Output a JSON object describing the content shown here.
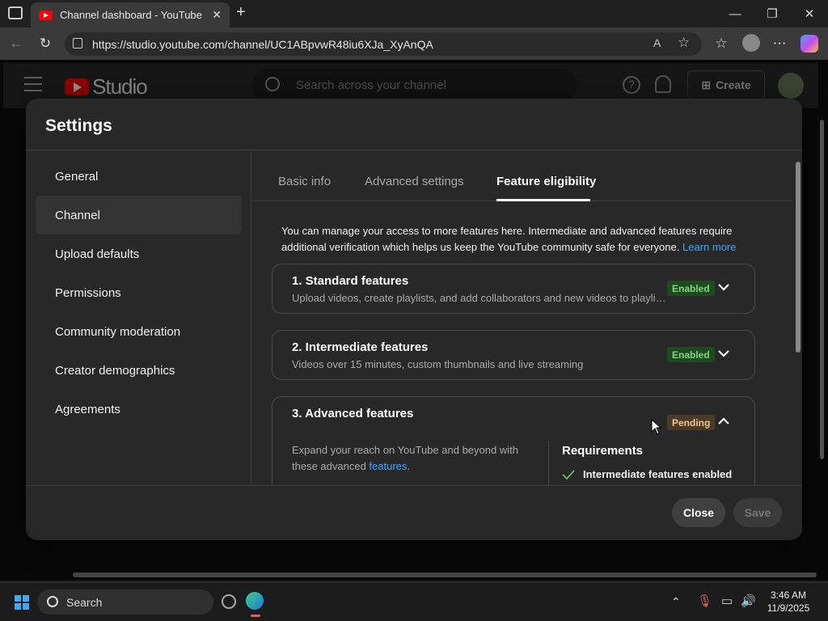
{
  "browser": {
    "tab_title": "Channel dashboard - YouTube Stu",
    "url": "https://studio.youtube.com/channel/UC1ABpvwR48iu6XJa_XyAnQA"
  },
  "studio": {
    "logo_text": "Studio",
    "search_placeholder": "Search across your channel",
    "create_label": "Create"
  },
  "dialog": {
    "title": "Settings",
    "nav": [
      {
        "label": "General"
      },
      {
        "label": "Channel"
      },
      {
        "label": "Upload defaults"
      },
      {
        "label": "Permissions"
      },
      {
        "label": "Community moderation"
      },
      {
        "label": "Creator demographics"
      },
      {
        "label": "Agreements"
      }
    ],
    "tabs": [
      {
        "label": "Basic info"
      },
      {
        "label": "Advanced settings"
      },
      {
        "label": "Feature eligibility"
      }
    ],
    "intro_text": "You can manage your access to more features here. Intermediate and advanced features require additional verification which helps us keep the YouTube community safe for everyone.",
    "intro_link": "Learn more",
    "cards": [
      {
        "title": "1. Standard features",
        "desc": "Upload videos, create playlists, and add collaborators and new videos to playlists",
        "status": "Enabled"
      },
      {
        "title": "2. Intermediate features",
        "desc": "Videos over 15 minutes, custom thumbnails and live streaming",
        "status": "Enabled"
      },
      {
        "title": "3. Advanced features",
        "desc": "Expand your reach on YouTube and beyond with these advanced",
        "desc_link": "features",
        "status": "Pending",
        "requirements_title": "Requirements",
        "requirement_1": "Intermediate features enabled"
      }
    ],
    "close_label": "Close",
    "save_label": "Save"
  },
  "taskbar": {
    "search_label": "Search",
    "time": "3:46 AM",
    "date": "11/9/2025"
  },
  "colors": {
    "accent_link": "#3ea6ff",
    "enabled_badge": "#7fd67f",
    "pending_badge": "#f2c38f",
    "yt_red": "#ff0000"
  }
}
